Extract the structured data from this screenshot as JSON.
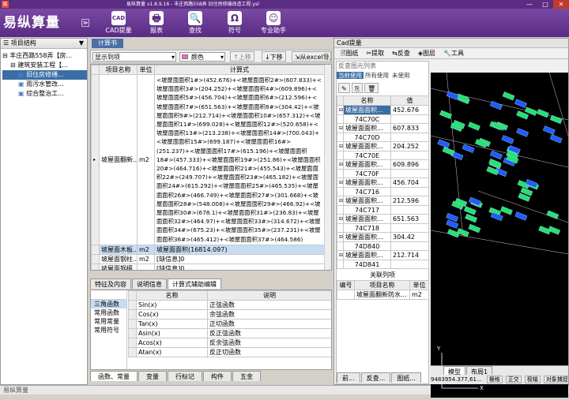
{
  "window": {
    "title": "易纵算量 v1.8.9.16 - 丰庄西路558弄 旧住房修缮改造工程.ysl",
    "min": "—",
    "max": "□",
    "close": "✕"
  },
  "app": {
    "logo": "易纵算量",
    "menu_btn": "≫"
  },
  "toolbar": [
    {
      "label": "CAD提量",
      "icon": "CAD"
    },
    {
      "label": "报表",
      "icon": "🖶"
    },
    {
      "label": "查找",
      "icon": "🔍"
    },
    {
      "label": "符号",
      "icon": "Ω"
    },
    {
      "label": "专业助手",
      "icon": "☺"
    }
  ],
  "project_tree": {
    "title": "项目结构",
    "items": [
      {
        "label": "丰庄西路558弄【房...",
        "level": 0,
        "toggle": "⊟"
      },
      {
        "label": "建筑安装工程【...",
        "level": 1,
        "toggle": "⊟"
      },
      {
        "label": "旧住房修缮...",
        "level": 2,
        "toggle": ""
      },
      {
        "label": "雨污水管改...",
        "level": 2,
        "toggle": ""
      },
      {
        "label": "综合整治工...",
        "level": 2,
        "toggle": ""
      }
    ]
  },
  "calc_tab": "计算书",
  "calc_toolbar": {
    "show_select": "显示到项",
    "color_label": "颜色",
    "up": "上移",
    "down": "下移",
    "import": "从excel导入"
  },
  "calc_table": {
    "headers": [
      "项目名称",
      "单位",
      "计算式"
    ],
    "rows": [
      {
        "name": "坡屋面翻新...",
        "unit": "m2",
        "formula": "<坡屋面面积1#>(452.676)+<坡屋面面积2#>(607.833)+<坡屋面面积3#>(204.252)+<坡屋面面积4#>(609.896)+<坡屋面面积5#>(456.704)+<坡屋面面积6#>(212.596)+<坡屋面面积7#>(651.563)+<坡屋面面积8#>(304.42)+<坡屋面面积9#>(212.714)+<坡屋面面积10#>(657.312)+<坡屋面面积11#>(699.028)+<坡屋面面积12#>(520.658)+<坡屋面面积13#>(213.238)+<坡屋面面积14#>(700.043)+<坡屋面面积15#>(699.187)+<坡屋面面积16#>(251.237)+<坡屋面面积17#>(615.196)+<坡屋面面积18#>(457.333)+<坡屋面面积19#>(251.86)+<坡屋面面积20#>(464.716)+<坡屋面面积21#>(455.543)+<坡屋面面积22#>(249.707)+<坡屋面面积23#>(465.182)+<坡屋面面积24#>(615.292)+<坡屋面面积25#>(465.535)+<坡屋面面积26#>(466.749)+<坡屋面面积27#>(301.668)+<坡屋面面积28#>(548.008)+<坡屋面面积29#>(466.92)+<坡屋面面积30#>(678.1)+<坡屋面面积31#>(236.83)+<坡屋面面积32#>(464.97)+<坡屋面面积33#>(314.672)+<坡屋面面积34#>(675.23)+<坡屋面面积35#>(237.231)+<坡屋面面积36#>(465.412)+<坡屋面面积37#>(464.586)"
      },
      {
        "name": "坡屋面木板...",
        "unit": "m2",
        "formula": "坡屋面面积(16814.097)"
      },
      {
        "name": "坡屋面钢柱...",
        "unit": "m2",
        "formula": "[缺信息]0"
      },
      {
        "name": "坡屋面钢檩...",
        "unit": "",
        "formula": "[缺信息]0"
      }
    ]
  },
  "bottom_tabs": [
    "特征及内容",
    "说明信息",
    "计算式辅助编辑"
  ],
  "func_categories": [
    "三角函数",
    "常用函数",
    "常用常量",
    "常用符号"
  ],
  "func_table": {
    "headers": [
      "名称",
      "说明"
    ],
    "rows": [
      {
        "name": "Sin(x)",
        "desc": "正弦函数"
      },
      {
        "name": "Cos(x)",
        "desc": "余弦函数"
      },
      {
        "name": "Tan(x)",
        "desc": "正切函数"
      },
      {
        "name": "Asin(x)",
        "desc": "反正弦函数"
      },
      {
        "name": "Acos(x)",
        "desc": "反余弦函数"
      },
      {
        "name": "Atan(x)",
        "desc": "反正切函数"
      }
    ]
  },
  "bottom_tabs2": [
    "函数、常量",
    "变量",
    "行标记",
    "构件",
    "五金"
  ],
  "cad": {
    "title": "Cad提量",
    "menu": [
      "图纸",
      "提取",
      "反查",
      "图层",
      "工具"
    ],
    "review_title": "反查图元列表",
    "tabs": [
      "当前使用",
      "所有使用",
      "未使用"
    ],
    "col_name": "名称",
    "col_value": "值",
    "rows": [
      {
        "name": "坡屋面面积...",
        "value": "452.676",
        "code": "74C70C"
      },
      {
        "name": "坡屋面面积...",
        "value": "607.833",
        "code": "74C70D"
      },
      {
        "name": "坡屋面面积...",
        "value": "204.252",
        "code": "74C70E"
      },
      {
        "name": "坡屋面面积...",
        "value": "609.896",
        "code": "74C70F"
      },
      {
        "name": "坡屋面面积...",
        "value": "456.704",
        "code": "74C716"
      },
      {
        "name": "坡屋面面积...",
        "value": "212.596",
        "code": "74C717"
      },
      {
        "name": "坡屋面面积...",
        "value": "651.563",
        "code": "74C718"
      },
      {
        "name": "坡屋面面积...",
        "value": "304.42",
        "code": "74D840"
      },
      {
        "name": "坡屋面面积...",
        "value": "212.714",
        "code": "74D841"
      }
    ],
    "rel_title": "关联列项",
    "rel_headers": [
      "编号",
      "项目名称",
      "单位"
    ],
    "rel_row": {
      "code": "",
      "name": "坡屋面翻新防水...",
      "unit": "m2"
    },
    "bottom_tabs": [
      "前...",
      "反查...",
      "图纸..."
    ],
    "model_tabs": [
      "模型",
      "布局1"
    ],
    "coords": "9483954.377,61...",
    "status_btns": [
      "栅格",
      "正交",
      "极轴",
      "对象捕捉"
    ]
  }
}
